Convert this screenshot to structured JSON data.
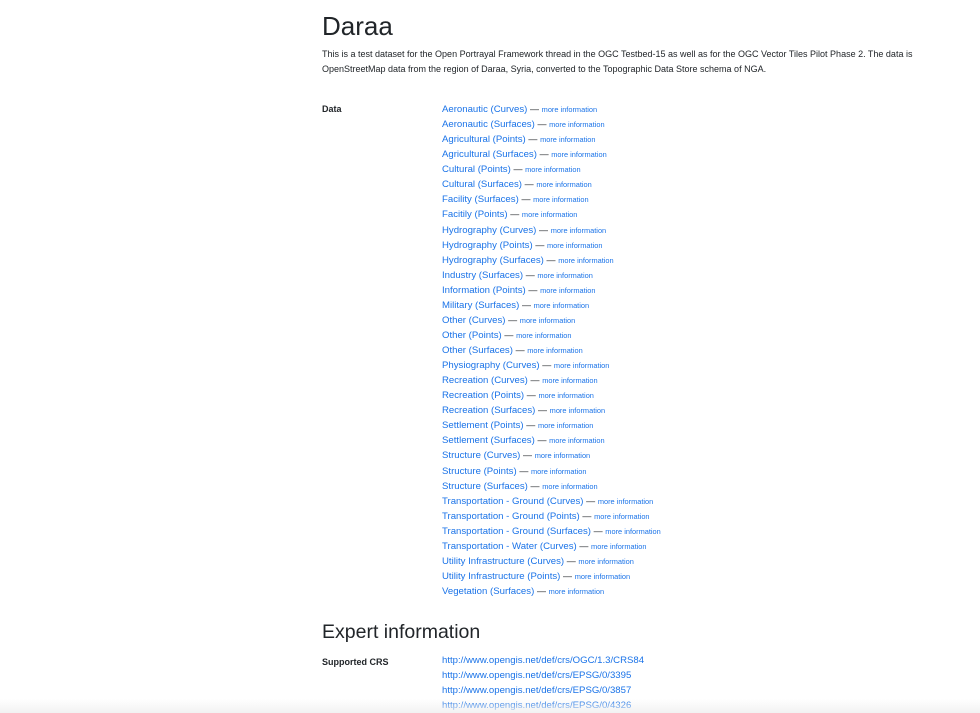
{
  "title": "Daraa",
  "description_line1": "This is a test dataset for the Open Portrayal Framework thread in the OGC Testbed-15 as well as for the OGC Vector Tiles Pilot Phase 2. The data is",
  "description_line2": "OpenStreetMap data from the region of Daraa, Syria, converted to the Topographic Data Store schema of NGA.",
  "data_label": "Data",
  "separator": "—",
  "more_label": "more information",
  "collections": [
    "Aeronautic (Curves)",
    "Aeronautic (Surfaces)",
    "Agricultural (Points)",
    "Agricultural (Surfaces)",
    "Cultural (Points)",
    "Cultural (Surfaces)",
    "Facility (Surfaces)",
    "Facitily (Points)",
    "Hydrography (Curves)",
    "Hydrography (Points)",
    "Hydrography (Surfaces)",
    "Industry (Surfaces)",
    "Information (Points)",
    "Military (Surfaces)",
    "Other (Curves)",
    "Other (Points)",
    "Other (Surfaces)",
    "Physiography (Curves)",
    "Recreation (Curves)",
    "Recreation (Points)",
    "Recreation (Surfaces)",
    "Settlement (Points)",
    "Settlement (Surfaces)",
    "Structure (Curves)",
    "Structure (Points)",
    "Structure (Surfaces)",
    "Transportation - Ground (Curves)",
    "Transportation - Ground (Points)",
    "Transportation - Ground (Surfaces)",
    "Transportation - Water (Curves)",
    "Utility Infrastructure (Curves)",
    "Utility Infrastructure (Points)",
    "Vegetation (Surfaces)"
  ],
  "expert_heading": "Expert information",
  "crs_label": "Supported CRS",
  "crs": [
    "http://www.opengis.net/def/crs/OGC/1.3/CRS84",
    "http://www.opengis.net/def/crs/EPSG/0/3395",
    "http://www.opengis.net/def/crs/EPSG/0/3857",
    "http://www.opengis.net/def/crs/EPSG/0/4326"
  ],
  "colors": {
    "link": "#1a73e8",
    "text": "#212529"
  }
}
